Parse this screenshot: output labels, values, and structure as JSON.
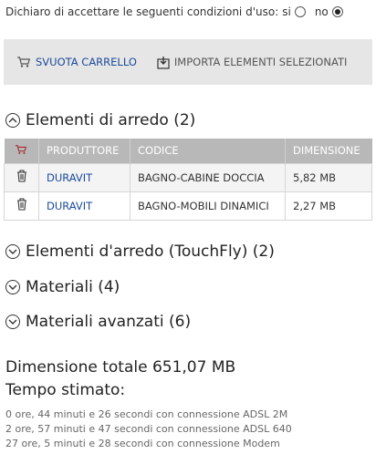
{
  "terms": {
    "question": "Dichiaro di accettare le seguenti condizioni d'uso:",
    "yes_label": "si",
    "no_label": "no",
    "selected": "no"
  },
  "toolbar": {
    "empty_cart_label": "SVUOTA CARRELLO",
    "import_label": "IMPORTA ELEMENTI SELEZIONATI"
  },
  "sections": [
    {
      "label": "Elementi di arredo (2)",
      "expanded": true
    },
    {
      "label": "Elementi d'arredo (TouchFly) (2)",
      "expanded": false
    },
    {
      "label": "Materiali (4)",
      "expanded": false
    },
    {
      "label": "Materiali avanzati (6)",
      "expanded": false
    }
  ],
  "table": {
    "columns": [
      "PRODUTTORE",
      "CODICE",
      "DIMENSIONE"
    ],
    "rows": [
      {
        "producer": "DURAVIT",
        "code": "BAGNO-CABINE DOCCIA",
        "size": "5,82 MB"
      },
      {
        "producer": "DURAVIT",
        "code": "BAGNO-MOBILI DINAMICI",
        "size": "2,27 MB"
      }
    ]
  },
  "summary": {
    "total": "Dimensione totale 651,07 MB",
    "time_title": "Tempo stimato:",
    "estimates": [
      "0 ore, 44 minuti e 26 secondi con connessione ADSL 2M",
      "2 ore, 57 minuti e 47 secondi con connessione ADSL 640",
      "27 ore, 5 minuti e 28 secondi con connessione Modem"
    ]
  },
  "colors": {
    "link": "#1b4a9c",
    "toolbar_bg": "#e6e6e6",
    "header_bg": "#b8b8b8"
  }
}
